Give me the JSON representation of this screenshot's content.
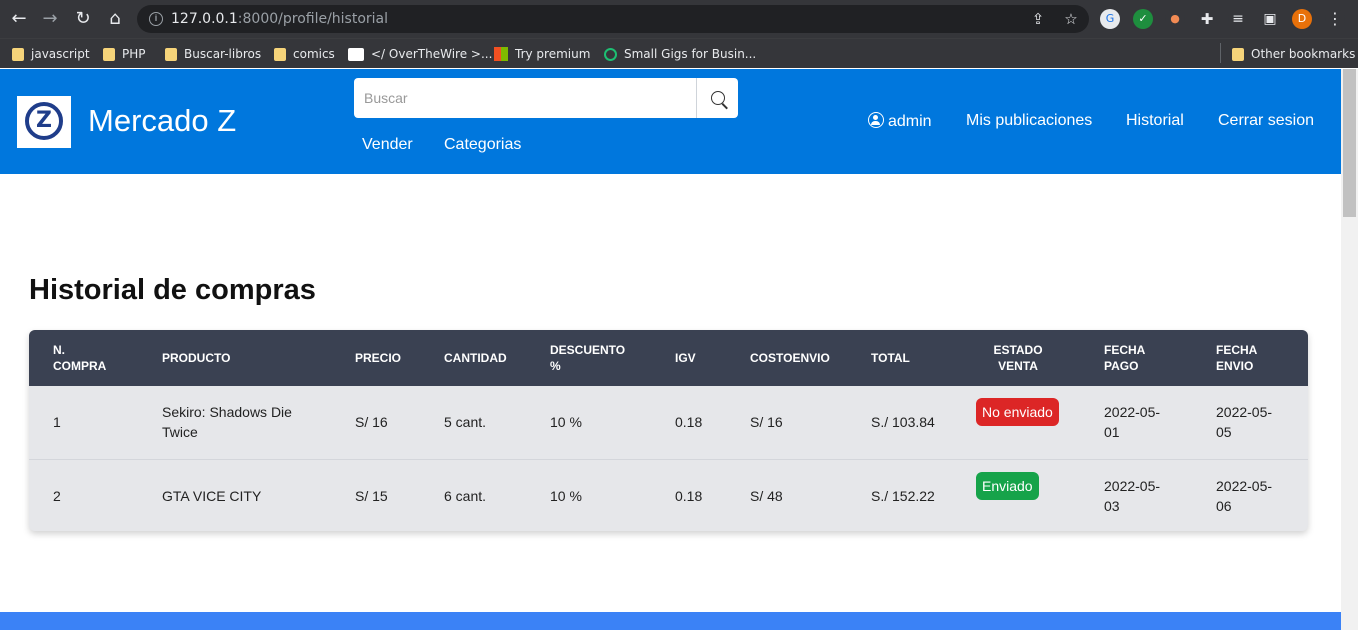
{
  "browser": {
    "url_host": "127.0.0.1",
    "url_rest": ":8000/profile/historial",
    "profile_initial": "D",
    "bookmarks": [
      "javascript",
      "PHP",
      "Buscar-libros",
      "comics",
      "</ OverTheWire >...",
      "Try premium",
      "Small Gigs for Busin...",
      "Other bookmarks"
    ]
  },
  "navbar": {
    "brand": "Mercado Z",
    "search_placeholder": "Buscar",
    "sub_links": [
      "Vender",
      "Categorias"
    ],
    "user": "admin",
    "links": [
      "Mis publicaciones",
      "Historial",
      "Cerrar sesion"
    ]
  },
  "page": {
    "title": "Historial de compras"
  },
  "table": {
    "headers": [
      "N.\nCOMPRA",
      "PRODUCTO",
      "PRECIO",
      "CANTIDAD",
      "DESCUENTO\n%",
      "IGV",
      "COSTOENVIO",
      "TOTAL",
      "ESTADO\nVENTA",
      "FECHA\nPAGO",
      "FECHA\nENVIO"
    ],
    "rows": [
      [
        "1",
        "Sekiro: Shadows Die Twice",
        "S/ 16",
        "5 cant.",
        "10 %",
        "0.18",
        "S/ 16",
        "S./ 103.84",
        "No enviado",
        "2022-05-01",
        "2022-05-05"
      ],
      [
        "2",
        "GTA VICE CITY",
        "S/ 15",
        "6 cant.",
        "10 %",
        "0.18",
        "S/ 48",
        "S./ 152.22",
        "Enviado",
        "2022-05-03",
        "2022-05-06"
      ]
    ],
    "status_colors": {
      "No enviado": "#dc2626",
      "Enviado": "#16a34a"
    }
  },
  "colors": {
    "navbar": "#0077dd",
    "table_header": "#3a4152",
    "table_body": "#e6e7ea"
  }
}
